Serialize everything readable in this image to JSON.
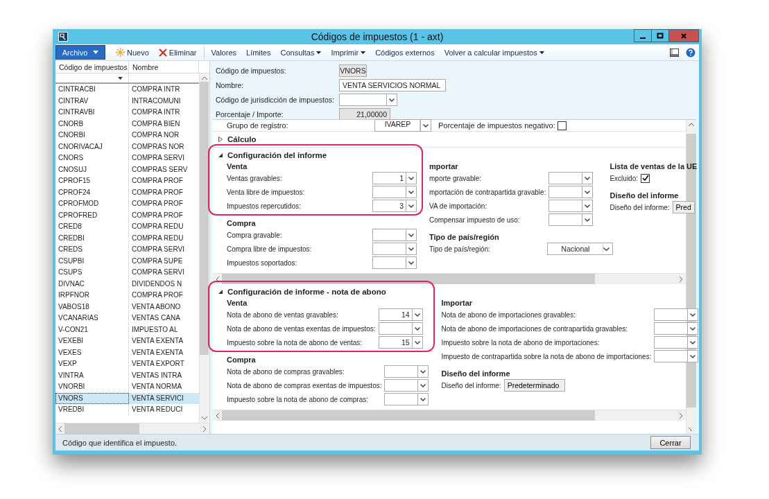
{
  "window": {
    "title": "Códigos de impuestos (1 - axt)"
  },
  "toolbar": [
    {
      "label": "Archivo",
      "kind": "file"
    },
    {
      "label": "Nuevo",
      "kind": "new"
    },
    {
      "label": "Eliminar",
      "kind": "delete"
    },
    {
      "label": "Valores",
      "kind": "plain"
    },
    {
      "label": "Límites",
      "kind": "plain"
    },
    {
      "label": "Consultas",
      "kind": "menu"
    },
    {
      "label": "Imprimir",
      "kind": "menu"
    },
    {
      "label": "Códigos externos",
      "kind": "plain"
    },
    {
      "label": "Volver a calcular impuestos",
      "kind": "menu"
    }
  ],
  "list": {
    "columns": [
      "Código de impuestos",
      "Nombre"
    ],
    "rows": [
      {
        "code": "CINTRACBI",
        "name": "COMPRA INTR",
        "selected": false
      },
      {
        "code": "CINTRAV",
        "name": "INTRACOMUNI",
        "selected": false
      },
      {
        "code": "CINTRAVBI",
        "name": "COMPRA INTR",
        "selected": false
      },
      {
        "code": "CNORB",
        "name": "COMPRA  BIEN",
        "selected": false
      },
      {
        "code": "CNORBI",
        "name": "COMPRA NOR",
        "selected": false
      },
      {
        "code": "CNORIVACAJ",
        "name": "COMPRAS NOR",
        "selected": false
      },
      {
        "code": "CNORS",
        "name": "COMPRA SERVI",
        "selected": false
      },
      {
        "code": "CNOSUJ",
        "name": "COMPRAS SERV",
        "selected": false
      },
      {
        "code": "CPROF15",
        "name": "COMPRA PROF",
        "selected": false
      },
      {
        "code": "CPROF24",
        "name": "COMPRA PROF",
        "selected": false
      },
      {
        "code": "CPROFMOD",
        "name": "COMPRA PROF",
        "selected": false
      },
      {
        "code": "CPROFRED",
        "name": "COMPRA PROF",
        "selected": false
      },
      {
        "code": "CRED8",
        "name": "COMPRA REDU",
        "selected": false
      },
      {
        "code": "CREDBI",
        "name": "COMPRA REDU",
        "selected": false
      },
      {
        "code": "CREDS",
        "name": "COMPRA SERVI",
        "selected": false
      },
      {
        "code": "CSUPBI",
        "name": "COMPRA SUPE",
        "selected": false
      },
      {
        "code": "CSUPS",
        "name": "COMPRA SERVI",
        "selected": false
      },
      {
        "code": "DIVNAC",
        "name": "DIVIDENDOS N",
        "selected": false
      },
      {
        "code": "IRPFNOR",
        "name": "COMPRA PROF",
        "selected": false
      },
      {
        "code": "VABOS18",
        "name": "VENTA ABONO",
        "selected": false
      },
      {
        "code": "VCANARIAS",
        "name": "VENTAS CANA",
        "selected": false
      },
      {
        "code": "V-CON21",
        "name": "IMPUESTO AL",
        "selected": false
      },
      {
        "code": "VEXEBI",
        "name": "VENTA EXENTA",
        "selected": false
      },
      {
        "code": "VEXES",
        "name": "VENTA EXENTA",
        "selected": false
      },
      {
        "code": "VEXP",
        "name": "VENTA EXPORT",
        "selected": false
      },
      {
        "code": "VINTRA",
        "name": "VENTAS INTRA",
        "selected": false
      },
      {
        "code": "VNORBI",
        "name": "VENTA NORMA",
        "selected": false
      },
      {
        "code": "VNORS",
        "name": "VENTA SERVICI",
        "selected": true
      },
      {
        "code": "VREDBI",
        "name": "VENTA REDUCI",
        "selected": false
      }
    ]
  },
  "header_fields": [
    {
      "label": "Código de impuestos:",
      "value": "VNORS",
      "kind": "readonly"
    },
    {
      "label": "Nombre:",
      "value": "VENTA SERVICIOS NORMAL",
      "kind": "text"
    },
    {
      "label": "Código de jurisdicción de impuestos:",
      "kind": "combo"
    },
    {
      "label": "Porcentaje / Importe:",
      "value": "21,00000",
      "kind": "number"
    }
  ],
  "posting": {
    "label": "Grupo de registro:",
    "value": "IVAREP",
    "negative_label": "Porcentaje de impuestos negativo:",
    "negative_checked": false
  },
  "sections": [
    {
      "title": "Cálculo",
      "expanded": false
    },
    {
      "title": "Configuración del informe",
      "expanded": true,
      "highlighted": true,
      "columns": [
        {
          "groups": [
            {
              "heading": "Venta",
              "fields": [
                {
                  "label": "Ventas gravables:",
                  "value": "1",
                  "kind": "combo"
                },
                {
                  "label": "Venta libre de impuestos:",
                  "kind": "combo"
                },
                {
                  "label": "Impuestos repercutidos:",
                  "value": "3",
                  "kind": "combo"
                }
              ]
            },
            {
              "heading": "Compra",
              "fields": [
                {
                  "label": "Compra gravable:",
                  "kind": "combo"
                },
                {
                  "label": "Compra libre de impuestos:",
                  "kind": "combo"
                },
                {
                  "label": "Impuestos soportados:",
                  "kind": "combo"
                }
              ]
            }
          ]
        },
        {
          "groups": [
            {
              "heading": "mportar",
              "fields": [
                {
                  "label": "mporte gravable:",
                  "kind": "combo"
                },
                {
                  "label": "mportación de contrapartida gravable:",
                  "kind": "combo"
                },
                {
                  "label": "VA de importación:",
                  "kind": "combo"
                },
                {
                  "label": "Compensar impuesto de uso:",
                  "kind": "combo"
                }
              ]
            },
            {
              "heading": "Tipo de país/región",
              "fields": [
                {
                  "label": "Tipo de país/región:",
                  "value": "Nacional",
                  "kind": "select"
                }
              ]
            }
          ]
        },
        {
          "groups": [
            {
              "heading": "Lista de ventas de la UE",
              "fields": [
                {
                  "label": "Excluido:",
                  "kind": "checkbox",
                  "checked": true
                }
              ]
            },
            {
              "heading": "Diseño del informe",
              "fields": [
                {
                  "label": "Diseño del informe:",
                  "value": "Pred",
                  "kind": "button"
                }
              ]
            }
          ]
        }
      ]
    },
    {
      "title": "Configuración de informe - nota de abono",
      "expanded": true,
      "highlighted": true,
      "columns": [
        {
          "groups": [
            {
              "heading": "Venta",
              "fields": [
                {
                  "label": "Nota de abono de ventas gravables:",
                  "value": "14",
                  "kind": "combo"
                },
                {
                  "label": "Nota de abono de ventas exentas de impuestos:",
                  "kind": "combo"
                },
                {
                  "label": "Impuesto sobre la nota de abono de ventas:",
                  "value": "15",
                  "kind": "combo"
                }
              ]
            },
            {
              "heading": "Compra",
              "fields": [
                {
                  "label": "Nota de abono de compras gravables:",
                  "kind": "combo"
                },
                {
                  "label": "Nota de abono de compras exentas de impuestos:",
                  "kind": "combo"
                },
                {
                  "label": "Impuesto sobre la nota de abono de compras:",
                  "kind": "combo"
                }
              ]
            }
          ]
        },
        {
          "groups": [
            {
              "heading": "Importar",
              "fields": [
                {
                  "label": "Nota de abono de importaciones gravables:",
                  "kind": "combo"
                },
                {
                  "label": "Nota de abono de importaciones de contrapartida gravables:",
                  "kind": "combo"
                },
                {
                  "label": "Impuesto sobre la nota de abono de importaciones:",
                  "kind": "combo"
                },
                {
                  "label": "Impuesto de contrapartida sobre la nota de abono de importaciones:",
                  "kind": "combo"
                }
              ]
            },
            {
              "heading": "Diseño del informe",
              "fields": [
                {
                  "label": "Diseño del informe:",
                  "value": "Predeterminado",
                  "kind": "button"
                }
              ]
            }
          ]
        }
      ]
    }
  ],
  "status": {
    "text": "Código que identifica el impuesto.",
    "button": "Cerrar"
  }
}
